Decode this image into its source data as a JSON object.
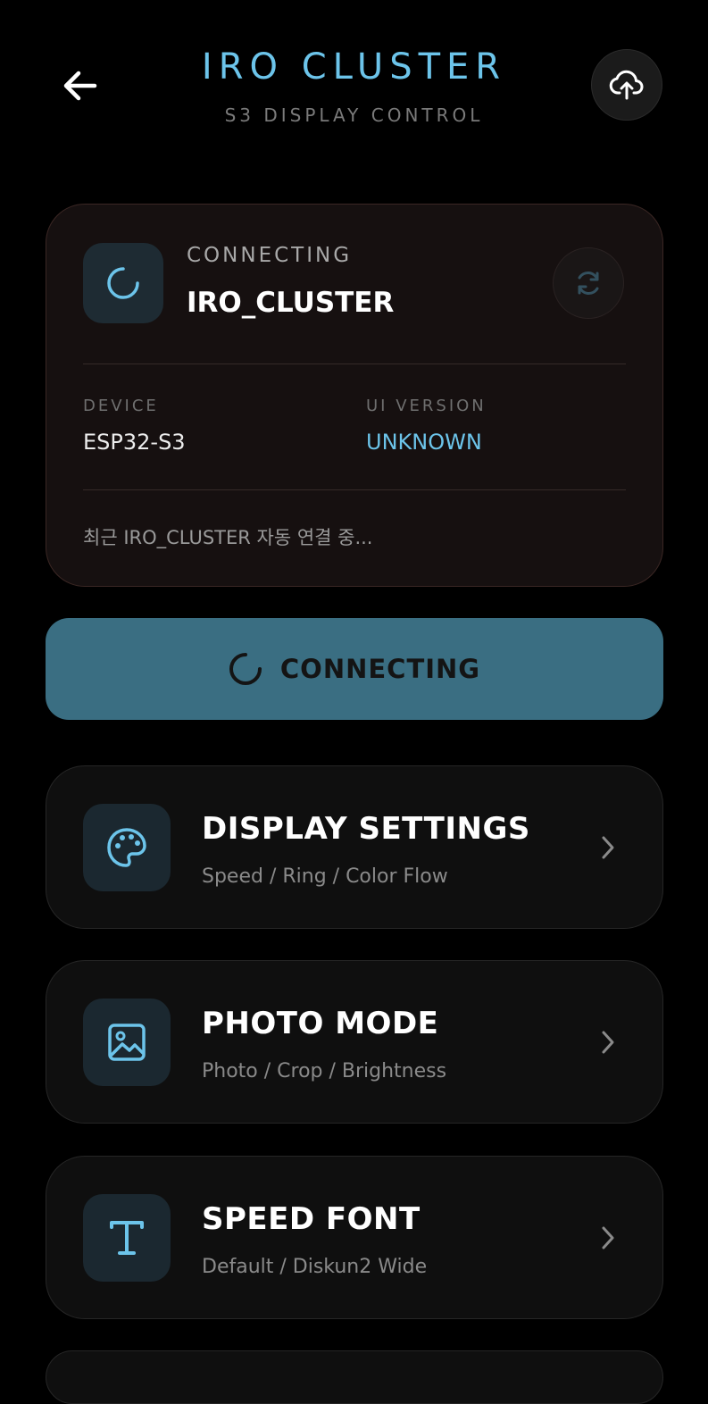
{
  "header": {
    "title": "IRO CLUSTER",
    "subtitle": "S3 DISPLAY CONTROL"
  },
  "status": {
    "state": "CONNECTING",
    "device_name": "IRO_CLUSTER",
    "device_label": "DEVICE",
    "device_value": "ESP32-S3",
    "ui_version_label": "UI VERSION",
    "ui_version_value": "UNKNOWN",
    "message": "최근 IRO_CLUSTER 자동 연결 중..."
  },
  "connect_button": {
    "label": "CONNECTING"
  },
  "menu": [
    {
      "title": "DISPLAY SETTINGS",
      "subtitle": "Speed / Ring / Color Flow",
      "icon": "palette-icon"
    },
    {
      "title": "PHOTO MODE",
      "subtitle": "Photo / Crop / Brightness",
      "icon": "image-icon"
    },
    {
      "title": "SPEED FONT",
      "subtitle": "Default / Diskun2 Wide",
      "icon": "text-icon"
    }
  ],
  "colors": {
    "accent": "#6cc4ea",
    "connect_button_bg": "#3a6e82",
    "background": "#000000"
  }
}
